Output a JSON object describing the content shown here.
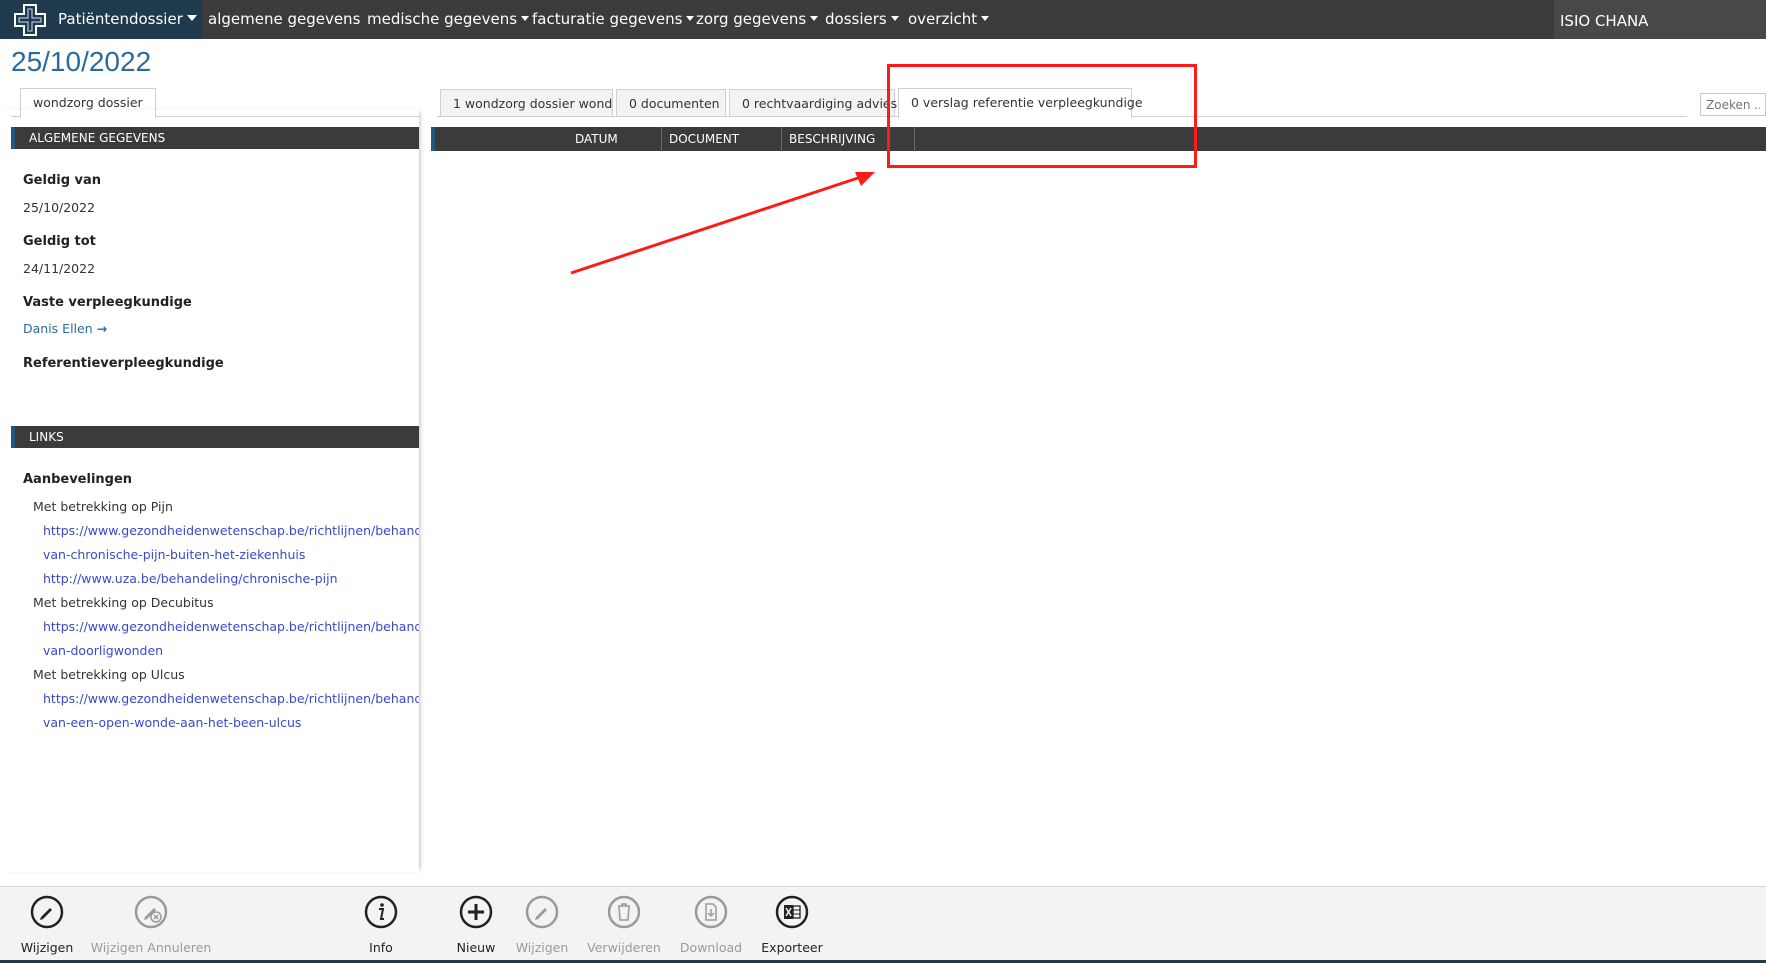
{
  "nav": {
    "brand_label": "Patiëntendossier",
    "items": [
      {
        "label": "algemene gegevens"
      },
      {
        "label": "medische gegevens"
      },
      {
        "label": "facturatie gegevens"
      },
      {
        "label": "zorg gegevens"
      },
      {
        "label": "dossiers"
      },
      {
        "label": "overzicht"
      }
    ],
    "user": "ISIO CHANA"
  },
  "page": {
    "date": "25/10/2022"
  },
  "left_tabs": [
    {
      "label": "wondzorg dossier"
    }
  ],
  "main_tabs": [
    {
      "label": "1 wondzorg dossier wond"
    },
    {
      "label": "0 documenten"
    },
    {
      "label": "0 rechtvaardiging advies"
    },
    {
      "label": "0 verslag referentie verpleegkundige"
    }
  ],
  "search": {
    "placeholder": "Zoeken ..."
  },
  "general": {
    "header": "ALGEMENE GEGEVENS",
    "valid_from_label": "Geldig van",
    "valid_from_value": "25/10/2022",
    "valid_to_label": "Geldig tot",
    "valid_to_value": "24/11/2022",
    "nurse_label": "Vaste verpleegkundige",
    "nurse_value": "Danis Ellen",
    "reference_nurse_label": "Referentieverpleegkundige"
  },
  "links": {
    "header": "LINKS",
    "recommendations_label": "Aanbevelingen",
    "groups": [
      {
        "label": "Met betrekking op Pijn",
        "urls": [
          "https://www.gezondheidenwetenschap.be/richtlijnen/behandeling-",
          "van-chronische-pijn-buiten-het-ziekenhuis",
          "http://www.uza.be/behandeling/chronische-pijn"
        ]
      },
      {
        "label": "Met betrekking op Decubitus",
        "urls": [
          "https://www.gezondheidenwetenschap.be/richtlijnen/behandeling-",
          "van-doorligwonden"
        ]
      },
      {
        "label": "Met betrekking op Ulcus",
        "urls": [
          "https://www.gezondheidenwetenschap.be/richtlijnen/behandeling-",
          "van-een-open-wonde-aan-het-been-ulcus"
        ]
      }
    ]
  },
  "grid": {
    "columns": [
      "DATUM",
      "DOCUMENT",
      "BESCHRIJVING"
    ]
  },
  "toolbar": {
    "edit": "Wijzigen",
    "cancel_edit": "Wijzigen Annuleren",
    "info": "Info",
    "new": "Nieuw",
    "edit2": "Wijzigen",
    "delete": "Verwijderen",
    "download": "Download",
    "export": "Exporteer"
  },
  "colors": {
    "annotation": "#ff1a1a",
    "accent_blue": "#2b6a9e",
    "link_blue": "#3a49c8"
  }
}
